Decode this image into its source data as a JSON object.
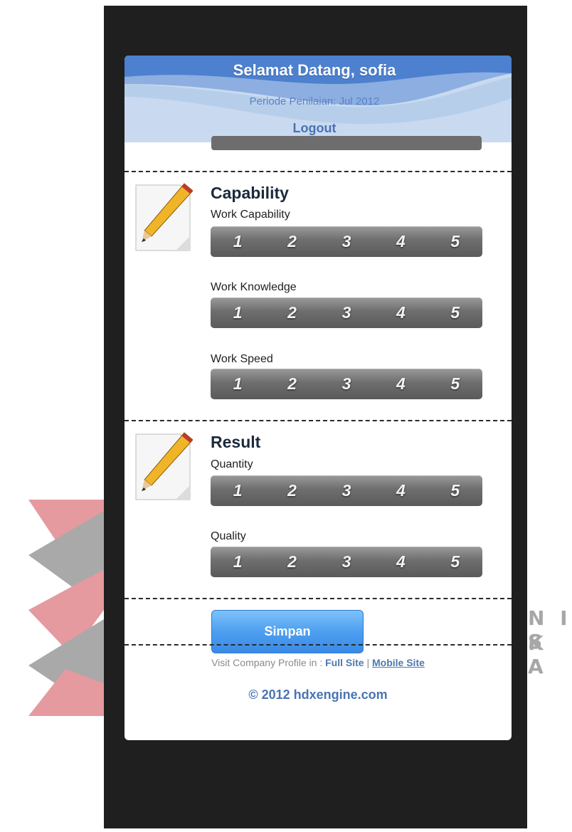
{
  "header": {
    "title": "Selamat Datang, sofia",
    "periode": "Periode Penilaian: Jul 2012",
    "logout": "Logout"
  },
  "sections": [
    {
      "title": "Capability",
      "icon": "pencil-paper-icon",
      "items": [
        {
          "label": "Work Capability",
          "options": [
            "1",
            "2",
            "3",
            "4",
            "5"
          ]
        },
        {
          "label": "Work Knowledge",
          "options": [
            "1",
            "2",
            "3",
            "4",
            "5"
          ]
        },
        {
          "label": "Work Speed",
          "options": [
            "1",
            "2",
            "3",
            "4",
            "5"
          ]
        }
      ]
    },
    {
      "title": "Result",
      "icon": "pencil-paper-icon",
      "items": [
        {
          "label": "Quantity",
          "options": [
            "1",
            "2",
            "3",
            "4",
            "5"
          ]
        },
        {
          "label": "Quality",
          "options": [
            "1",
            "2",
            "3",
            "4",
            "5"
          ]
        }
      ]
    }
  ],
  "submit_label": "Simpan",
  "footer": {
    "prefix": "Visit Company Profile in : ",
    "full_site": "Full Site",
    "separator": " | ",
    "mobile_site": "Mobile Site",
    "copyright": "© 2012 hdxengine.com"
  },
  "watermark_text": [
    "N I S",
    "K A"
  ],
  "colors": {
    "accent_blue": "#4d9ff0",
    "header_bg": "#c9daf0",
    "rating_bg": "#6e6e6e",
    "watermark_red": "#e49a9f",
    "watermark_gray": "#a7a7a7"
  }
}
